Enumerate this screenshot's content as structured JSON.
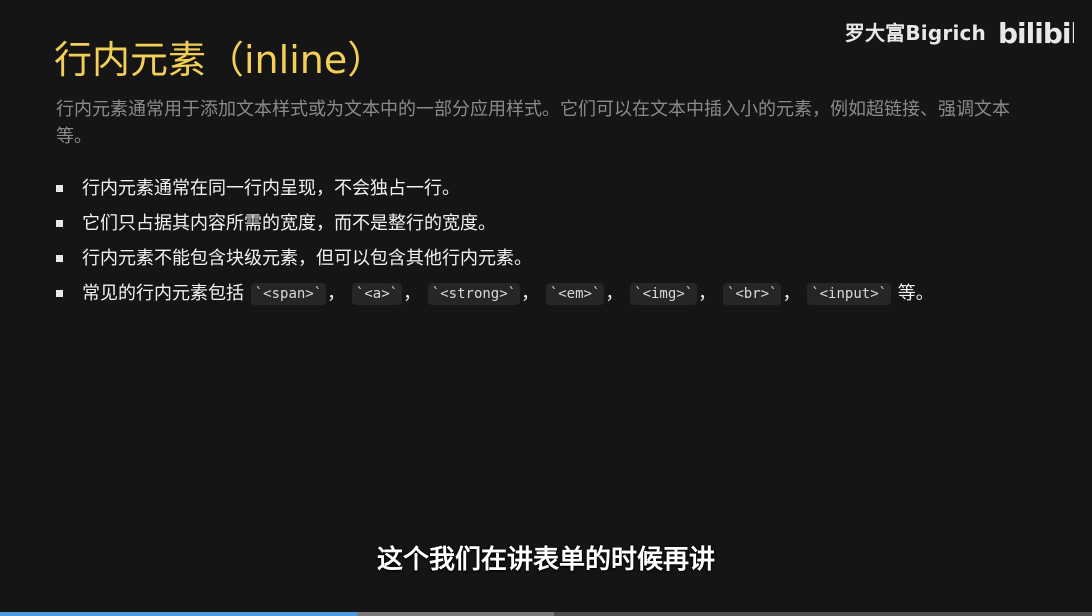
{
  "watermark": {
    "author": "罗大富Bigrich",
    "logo_name": "bilibili",
    "logo_text": "bilibili"
  },
  "slide": {
    "title": "行内元素（inline）",
    "subtitle": "行内元素通常用于添加文本样式或为文本中的一部分应用样式。它们可以在文本中插入小的元素，例如超链接、强调文本等。",
    "bullets": [
      {
        "text": "行内元素通常在同一行内呈现，不会独占一行。"
      },
      {
        "text": "它们只占据其内容所需的宽度，而不是整行的宽度。"
      },
      {
        "text": "行内元素不能包含块级元素，但可以包含其他行内元素。"
      },
      {
        "prefix": "常见的行内元素包括",
        "codes": [
          "`<span>`",
          "`<a>`",
          "`<strong>`",
          "`<em>`",
          "`<img>`",
          "`<br>`",
          "`<input>`"
        ],
        "separator": "，",
        "suffix": "等。"
      }
    ]
  },
  "caption": "这个我们在讲表单的时候再讲",
  "player": {
    "played_fraction": 0.327,
    "buffered_end_fraction": 0.507
  },
  "colors": {
    "background": "#151515",
    "title": "#f3cf57",
    "subtitle": "#8b8b8b",
    "text": "#f2f2f2",
    "progress": "#4c9ae0"
  }
}
